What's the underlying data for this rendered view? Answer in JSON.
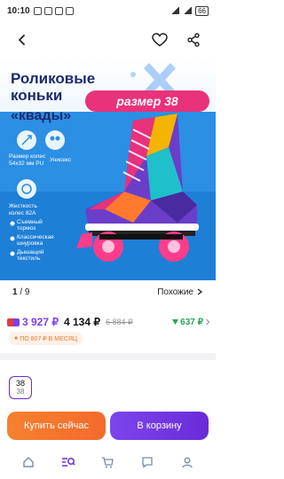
{
  "status_bar": {
    "time": "10:10",
    "battery": "66"
  },
  "top_nav": {
    "back_icon": "arrow-left-icon",
    "favorite_icon": "heart-icon",
    "share_icon": "share-icon"
  },
  "hero": {
    "title_line1": "Роликовые",
    "title_line2": "коньки",
    "title_line3": "«квады»",
    "size_label": "размер 38",
    "features": {
      "wheels": "Размер колес\n54х32 мм PU",
      "unisex": "Унисекс",
      "hardness": "Жесткость\nколес 82А",
      "brake": "Съемный\nтормоз",
      "laces": "Классическая\nшнуровка",
      "textile": "Дышащий\nтекстиль"
    },
    "colors": {
      "background": "#1e90e6",
      "title": "#1f2a6e",
      "size_badge": "#e8327a",
      "wheels": "#ff3d8b"
    }
  },
  "gallery": {
    "current": "1",
    "total": "/ 9",
    "similar_label": "Похожие"
  },
  "price": {
    "card_price": "3 927 ₽",
    "main_price": "4 134 ₽",
    "old_price": "6 884 ₽",
    "bonus": "637 ₽",
    "installment": "ПО 807 ₽ В МЕСЯЦ"
  },
  "size": {
    "value": "38",
    "sub": "38"
  },
  "actions": {
    "buy_now": "Купить сейчас",
    "add_to_cart": "В корзину"
  },
  "bottom_nav": {
    "home_icon": "home-icon",
    "search_icon": "search-icon",
    "cart_icon": "cart-icon",
    "chat_icon": "chat-icon",
    "profile_icon": "profile-icon"
  },
  "accent_colors": {
    "purple": "#6a2bd8",
    "orange": "#f46a2c",
    "green": "#2aa35a"
  }
}
